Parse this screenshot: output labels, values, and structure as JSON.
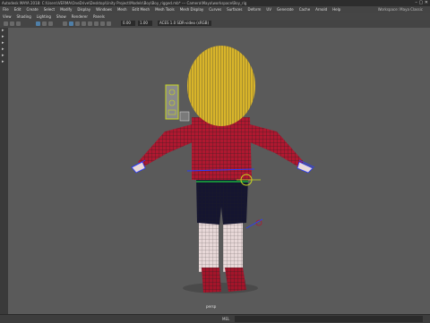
{
  "window": {
    "title": "Autodesk MAYA 2018: C:\\Users\\VERMA\\OneDrive\\Desktop\\Unity Project\\Models\\Boy\\Boy_rigged.mb* --- Camera\\Maya\\workspace\\Boy_rig",
    "controls": "–  ▢  ✕"
  },
  "menubar": {
    "items": [
      "File",
      "Edit",
      "Create",
      "Select",
      "Modify",
      "Display",
      "Windows",
      "Mesh",
      "Edit Mesh",
      "Mesh Tools",
      "Mesh Display",
      "Curves",
      "Surfaces",
      "Deform",
      "UV",
      "Generate",
      "Cache",
      "Arnold",
      "Help"
    ],
    "workspace": "Workspace: Maya Classic"
  },
  "panelmenu": {
    "items": [
      "View",
      "Shading",
      "Lighting",
      "Show",
      "Renderer",
      "Panels"
    ]
  },
  "viewtools": {
    "field1": "0.00",
    "field2": "1.00",
    "colorspace": "ACES 1.0 SDR-video (sRGB)"
  },
  "viewport": {
    "camera_label": "persp"
  },
  "statusbar": {
    "mel_label": "MEL"
  },
  "colors": {
    "viewport_bg": "#5a5a5a",
    "shirt": "#b01830",
    "hair": "#d8b42a",
    "shorts": "#151530",
    "skin_wire": "#e8d8d8",
    "controls": "#2a3cff",
    "selection": "#c8d820"
  },
  "icons": [
    "move-tool-icon",
    "rotate-tool-icon",
    "scale-tool-icon",
    "select-icon",
    "lasso-icon",
    "paint-icon",
    "camera-icon",
    "grid-icon",
    "wireframe-icon",
    "shaded-icon",
    "texture-icon",
    "light-icon",
    "shadow-icon",
    "isolate-icon"
  ]
}
